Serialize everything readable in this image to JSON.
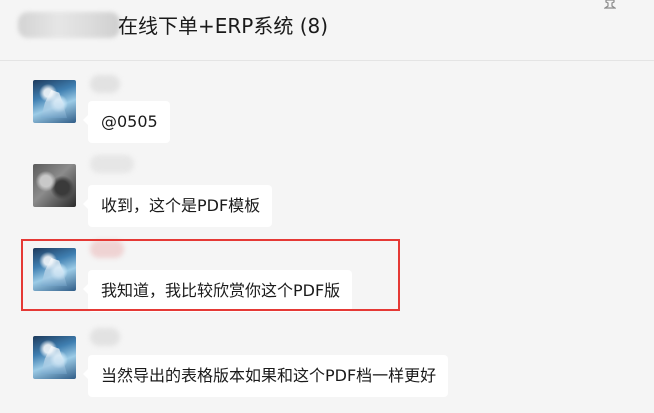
{
  "header": {
    "title": "在线下单+ERP系统 (8)",
    "pin_icon": "pin-icon"
  },
  "messages": [
    {
      "avatar": "anime-avatar",
      "text": "@0505"
    },
    {
      "avatar": "photo-avatar",
      "text": "收到，这个是PDF模板"
    },
    {
      "avatar": "anime-avatar",
      "text": "我知道，我比较欣赏你这个PDF版",
      "highlighted": true
    },
    {
      "avatar": "anime-avatar",
      "text": "当然导出的表格版本如果和这个PDF档一样更好"
    }
  ],
  "colors": {
    "background": "#f5f5f5",
    "bubble": "#ffffff",
    "highlight_border": "#e53935"
  }
}
